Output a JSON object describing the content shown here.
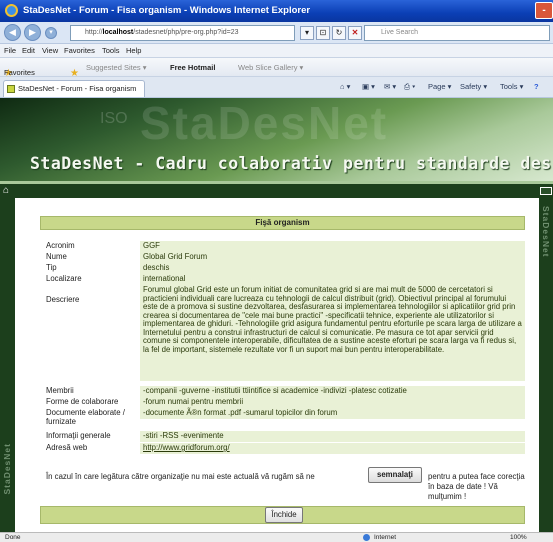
{
  "window": {
    "title": "StaDesNet - Forum - Fisa organism - Windows Internet Explorer",
    "close_glyph": "-"
  },
  "address": {
    "url_prefix": "http://",
    "url_host": "localhost",
    "url_path": "/stadesnet/php/pre-org.php?id=23",
    "search_placeholder": "Live Search"
  },
  "menu": {
    "items": [
      "File",
      "Edit",
      "View",
      "Favorites",
      "Tools",
      "Help"
    ]
  },
  "favorites_bar": {
    "favorites_label": "Favorites",
    "suggested_sites": "Suggested Sites ▾",
    "free_hotmail": "Free Hotmail",
    "web_slice": "Web Slice Gallery ▾"
  },
  "tab": {
    "label": "StaDesNet - Forum - Fisa organism"
  },
  "command_bar": {
    "page": "Page ▾",
    "safety": "Safety ▾",
    "tools": "Tools ▾"
  },
  "site": {
    "banner_title": "StaDesNet - Cadru colaborativ pentru standarde deschise",
    "side_label": "StaDesNet",
    "banner_ghost_small": "ISO"
  },
  "panel": {
    "heading": "Fişă organism",
    "fields": [
      {
        "label": "Acronim",
        "value": "GGF"
      },
      {
        "label": "Nume",
        "value": "Global Grid Forum"
      },
      {
        "label": "Tip",
        "value": "deschis"
      },
      {
        "label": "Localizare",
        "value": "international"
      },
      {
        "label": "Descriere",
        "value": "Forumul global Grid este un forum initiat de comunitatea grid si are mai mult de 5000 de cercetatori si practicieni individuali care lucreaza cu tehnologii de calcul distribuit (grid). Obiectivul principal al forumului este de a promova si sustine dezvoltarea, desfasurarea si implementarea tehnologiilor si aplicatiilor grid prin crearea si documentarea de \"cele mai bune practici\" -specificatii tehnice, experiente ale utilizatorilor si implementarea de ghiduri. -Tehnologiile grid asigura fundamentul pentru eforturile pe scara larga de utilizare a Internetului pentru a construi infrastructuri de calcul si comunicatie. Pe masura ce tot apar servicii grid comune si componentele interoperabile, dificultatea de a sustine aceste eforturi pe scara larga va fi redus si, la fel de important, sistemele rezultate vor fi un suport mai bun pentru interoperabilitate."
      },
      {
        "label": "Membrii",
        "value": "-companii -guverne -institutii ttiintifice si academice -indivizi -platesc cotizatie"
      },
      {
        "label": "Forme de colaborare",
        "value": "-forum numai pentru membrii"
      },
      {
        "label": "Documente elaborate / furnizate",
        "value": "-documente Ã®n format .pdf -sumarul topicilor din forum"
      },
      {
        "label": "Informaţii generale",
        "value": "-stiri -RSS -evenimente"
      },
      {
        "label": "Adresă web",
        "value": "http://www.gridforum.org/"
      }
    ],
    "notice_before": "În cazul în care legătura către organizaţie nu mai este actuală vă rugăm să ne",
    "report_button": "semnalaţi",
    "notice_after": "pentru a putea face corecţia în baza de date ! Vă mulţumim !",
    "close_button": "Închide"
  },
  "status": {
    "left": "Done",
    "zone": "Internet",
    "zoom": "100%"
  }
}
